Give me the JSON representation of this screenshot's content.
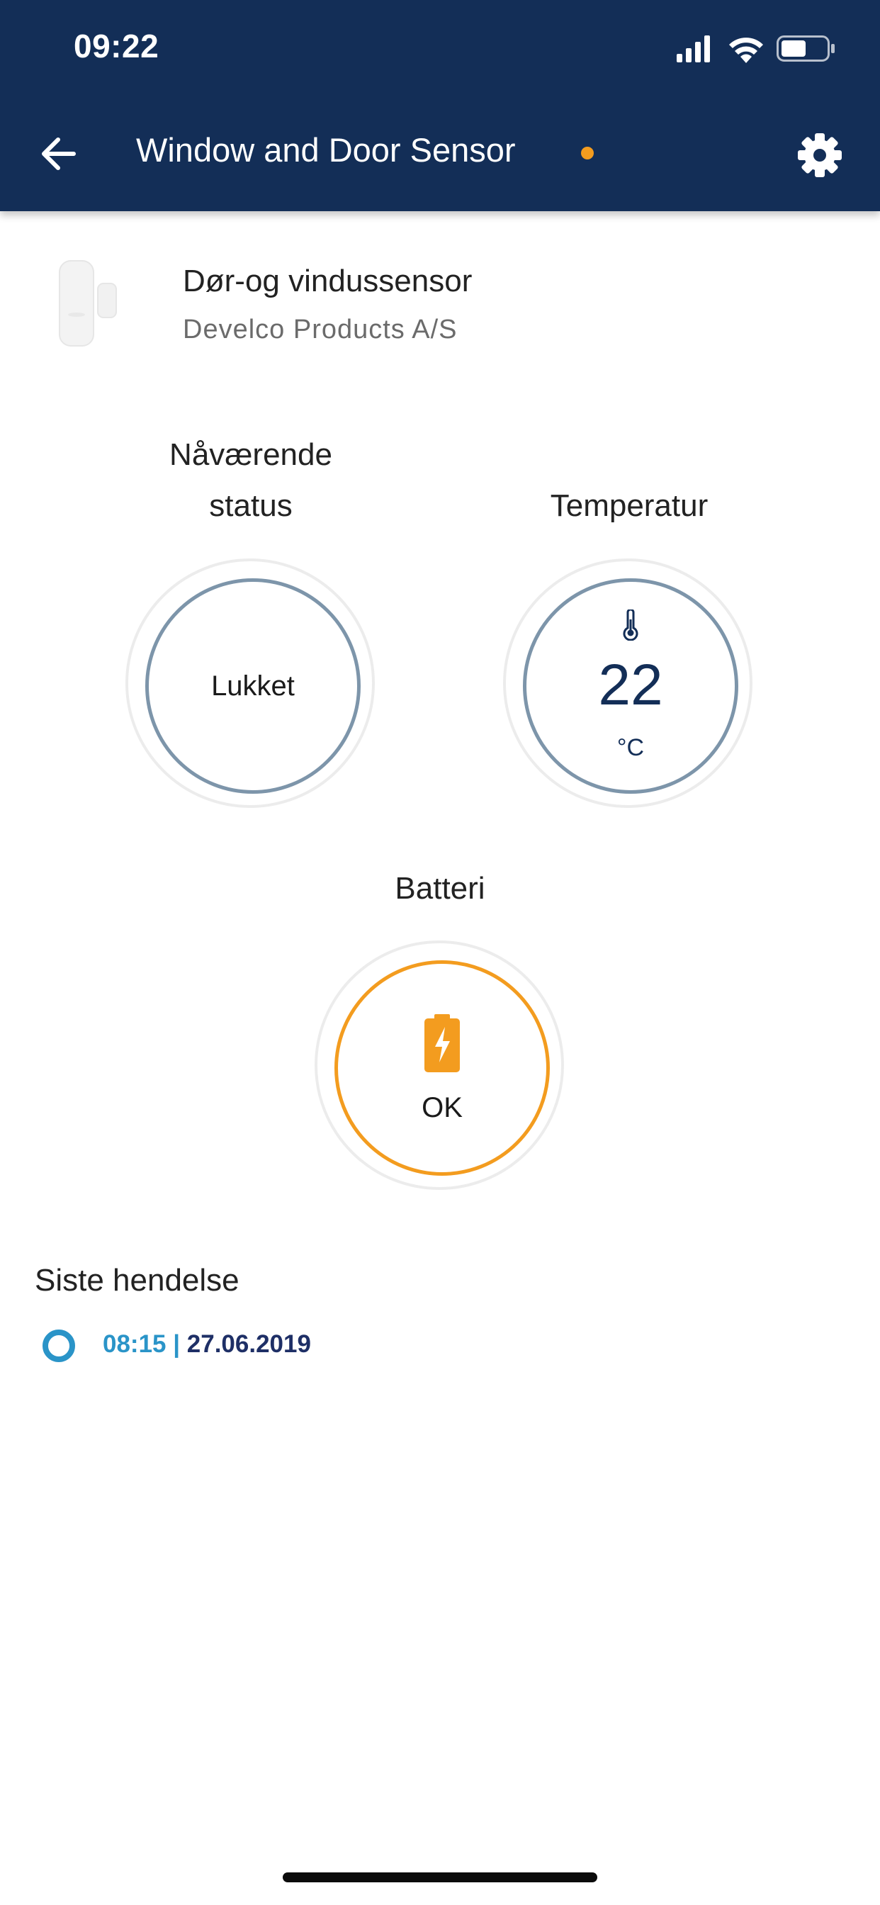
{
  "status_bar": {
    "time": "09:22",
    "icons": [
      "signal-icon",
      "wifi-icon",
      "battery-icon"
    ]
  },
  "nav": {
    "title": "Window and Door Sensor",
    "back_icon": "back-arrow-icon",
    "settings_icon": "gear-icon",
    "indicator_color": "#f39c1f"
  },
  "device": {
    "name": "Dør-og vindussensor",
    "manufacturer": "Develco Products A/S"
  },
  "gauges": {
    "status": {
      "label_line1": "Nåværende",
      "label_line2": "status",
      "value": "Lukket"
    },
    "temperature": {
      "label": "Temperatur",
      "value": "22",
      "unit": "°C",
      "icon": "thermometer-icon"
    },
    "battery": {
      "label": "Batteri",
      "value": "OK",
      "icon": "battery-charging-icon"
    }
  },
  "last_event": {
    "heading": "Siste hendelse",
    "time": "08:15",
    "separator": " | ",
    "date": "27.06.2019"
  },
  "colors": {
    "header_bg": "#132e57",
    "accent_orange": "#f39c1f",
    "gauge_ring": "#7d95aa",
    "event_blue": "#2a94c8",
    "event_date": "#1e2f66"
  }
}
